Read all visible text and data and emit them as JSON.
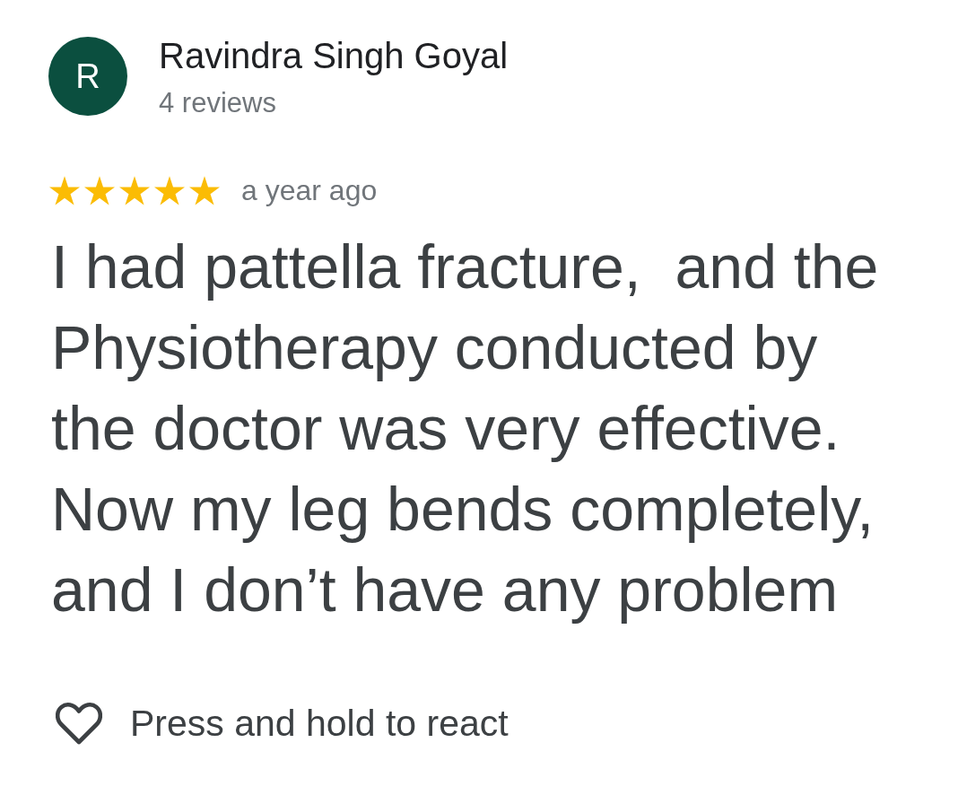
{
  "reviewer": {
    "initial": "R",
    "name": "Ravindra Singh Goyal",
    "review_count": "4 reviews"
  },
  "review": {
    "stars": 5,
    "time": "a year ago",
    "text": "I had pattella fracture,  and the Physiotherapy conducted by the doctor was very effective. Now my leg bends completely, and I don’t have any problem"
  },
  "reaction": {
    "label": "Press and hold to react"
  }
}
